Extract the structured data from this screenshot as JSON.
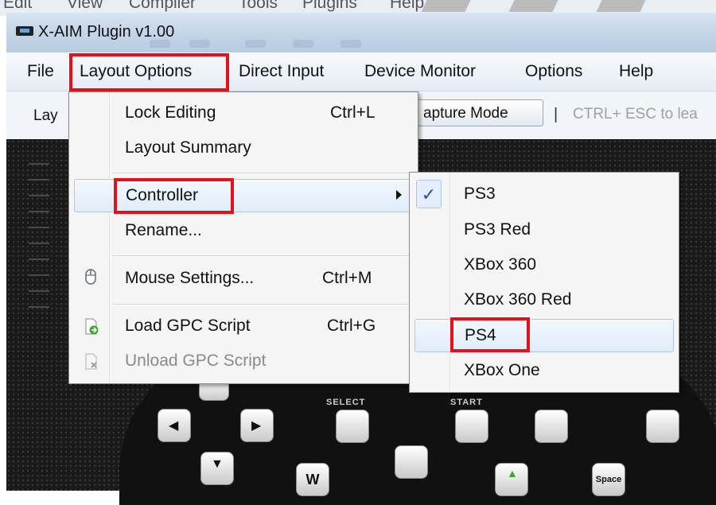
{
  "window": {
    "title": "X-AIM Plugin v1.00"
  },
  "parent_menubar": {
    "items": [
      "Edit",
      "View",
      "Compiler",
      "Tools",
      "Plugins",
      "Help"
    ]
  },
  "menubar": {
    "items": [
      "File",
      "Layout Options",
      "Direct Input",
      "Device Monitor",
      "Options",
      "Help"
    ],
    "active": "Layout Options"
  },
  "toolbar": {
    "layout_label_partial": "Lay",
    "capture_button": "apture Mode",
    "separator": "|",
    "hint": "CTRL+ ESC to lea"
  },
  "layout_menu": {
    "items": [
      {
        "label": "Lock Editing",
        "shortcut": "Ctrl+L",
        "icon": null,
        "disabled": false
      },
      {
        "label": "Layout Summary",
        "shortcut": "",
        "icon": null,
        "disabled": false
      },
      {
        "label": "Controller",
        "shortcut": "",
        "icon": null,
        "disabled": false,
        "submenu": true,
        "hovered": true
      },
      {
        "label": "Rename...",
        "shortcut": "",
        "icon": null,
        "disabled": false
      },
      {
        "label": "Mouse Settings...",
        "shortcut": "Ctrl+M",
        "icon": "mouse-icon",
        "disabled": false
      },
      {
        "label": "Load GPC Script",
        "shortcut": "Ctrl+G",
        "icon": "load-script-icon",
        "disabled": false
      },
      {
        "label": "Unload GPC Script",
        "shortcut": "",
        "icon": "unload-script-icon",
        "disabled": true
      }
    ]
  },
  "controller_menu": {
    "items": [
      {
        "label": "PS3",
        "checked": true
      },
      {
        "label": "PS3 Red",
        "checked": false
      },
      {
        "label": "XBox 360",
        "checked": false
      },
      {
        "label": "XBox 360 Red",
        "checked": false
      },
      {
        "label": "PS4",
        "checked": false,
        "hovered": true
      },
      {
        "label": "XBox One",
        "checked": false
      }
    ],
    "check_glyph": "✓"
  },
  "gamepad": {
    "select_label": "SELECT",
    "start_label": "START",
    "w_key": "W",
    "space_key": "Space"
  },
  "colors": {
    "highlight_box": "#e3111a",
    "menu_hover": "#e0edf9",
    "canvas": "#1a1a1a"
  }
}
